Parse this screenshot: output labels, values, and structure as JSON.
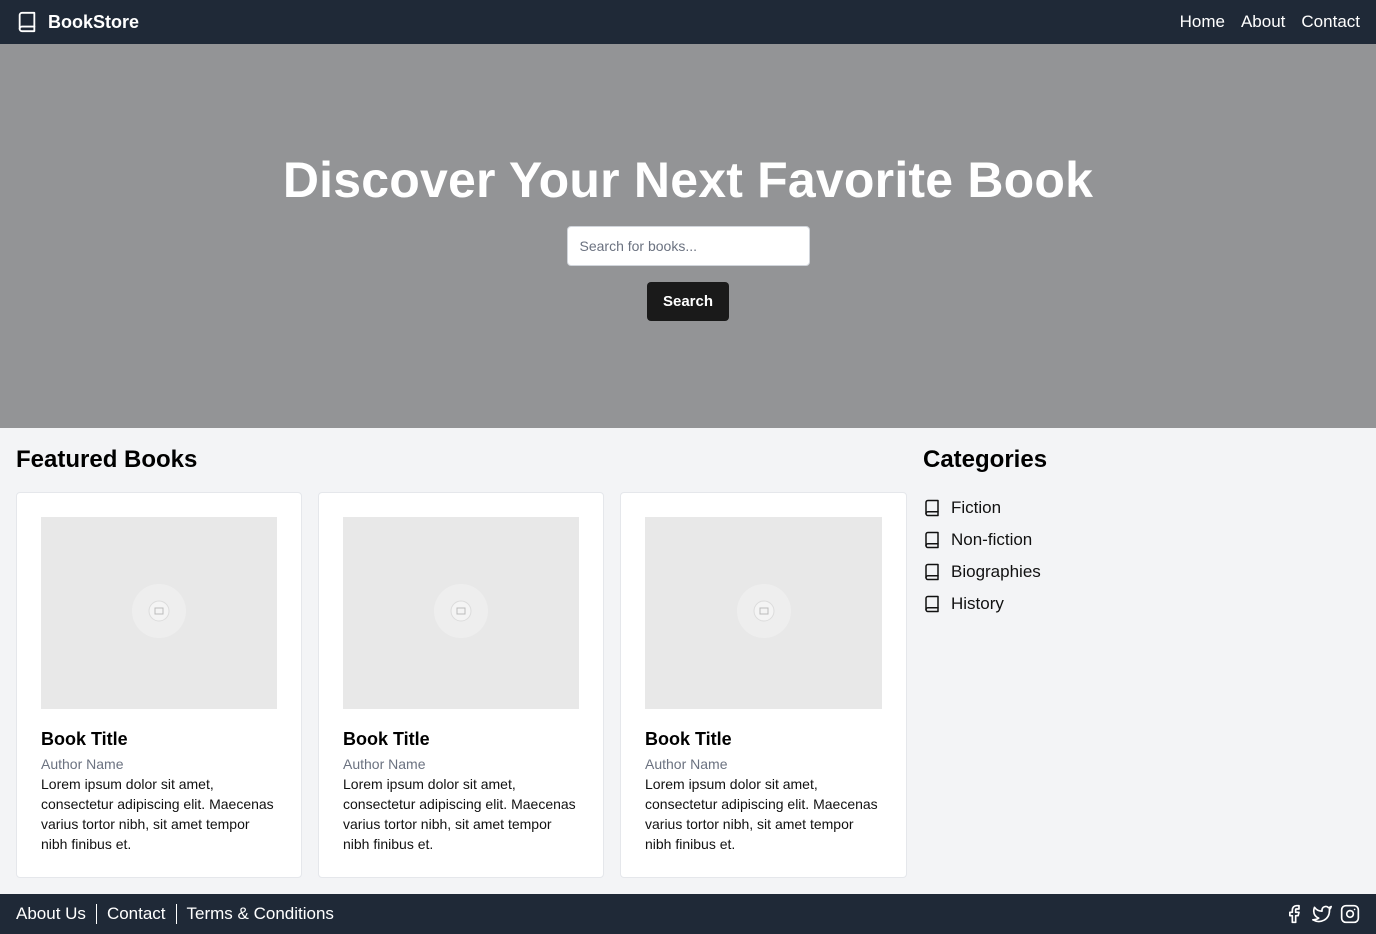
{
  "header": {
    "brand": "BookStore",
    "nav": [
      "Home",
      "About",
      "Contact"
    ]
  },
  "hero": {
    "title": "Discover Your Next Favorite Book",
    "search_placeholder": "Search for books...",
    "search_button": "Search"
  },
  "featured": {
    "title": "Featured Books",
    "books": [
      {
        "title": "Book Title",
        "author": "Author Name",
        "description": "Lorem ipsum dolor sit amet, consectetur adipiscing elit. Maecenas varius tortor nibh, sit amet tempor nibh finibus et."
      },
      {
        "title": "Book Title",
        "author": "Author Name",
        "description": "Lorem ipsum dolor sit amet, consectetur adipiscing elit. Maecenas varius tortor nibh, sit amet tempor nibh finibus et."
      },
      {
        "title": "Book Title",
        "author": "Author Name",
        "description": "Lorem ipsum dolor sit amet, consectetur adipiscing elit. Maecenas varius tortor nibh, sit amet tempor nibh finibus et."
      }
    ]
  },
  "categories": {
    "title": "Categories",
    "items": [
      "Fiction",
      "Non-fiction",
      "Biographies",
      "History"
    ]
  },
  "footer": {
    "links": [
      "About Us",
      "Contact",
      "Terms & Conditions"
    ],
    "social_icons": [
      "facebook-icon",
      "twitter-icon",
      "instagram-icon"
    ]
  },
  "colors": {
    "header_bg": "#1f2937",
    "hero_bg": "#939496",
    "page_bg": "#f3f4f6",
    "button_bg": "#1a1a1a"
  }
}
